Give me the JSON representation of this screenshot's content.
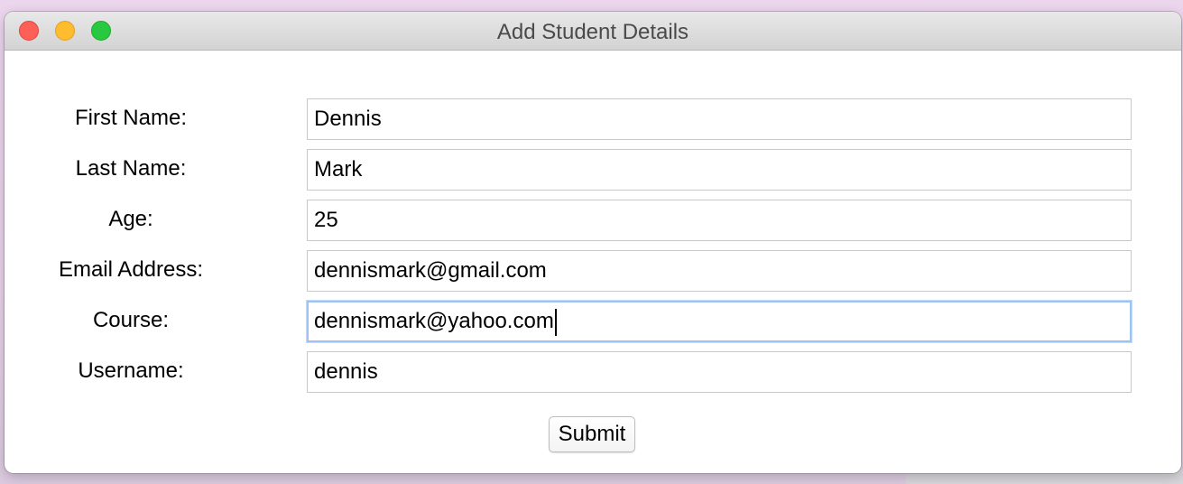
{
  "window": {
    "title": "Add Student Details"
  },
  "form": {
    "fields": [
      {
        "label": "First Name:",
        "value": "Dennis"
      },
      {
        "label": "Last Name:",
        "value": "Mark"
      },
      {
        "label": "Age:",
        "value": "25"
      },
      {
        "label": "Email Address:",
        "value": "dennismark@gmail.com"
      },
      {
        "label": "Course:",
        "value": "dennismark@yahoo.com"
      },
      {
        "label": "Username:",
        "value": "dennis"
      }
    ],
    "submit_label": "Submit"
  },
  "colors": {
    "close": "#fe5f57",
    "minimize": "#febc2e",
    "maximize": "#28c840",
    "focus_ring": "#9cc3f3"
  }
}
